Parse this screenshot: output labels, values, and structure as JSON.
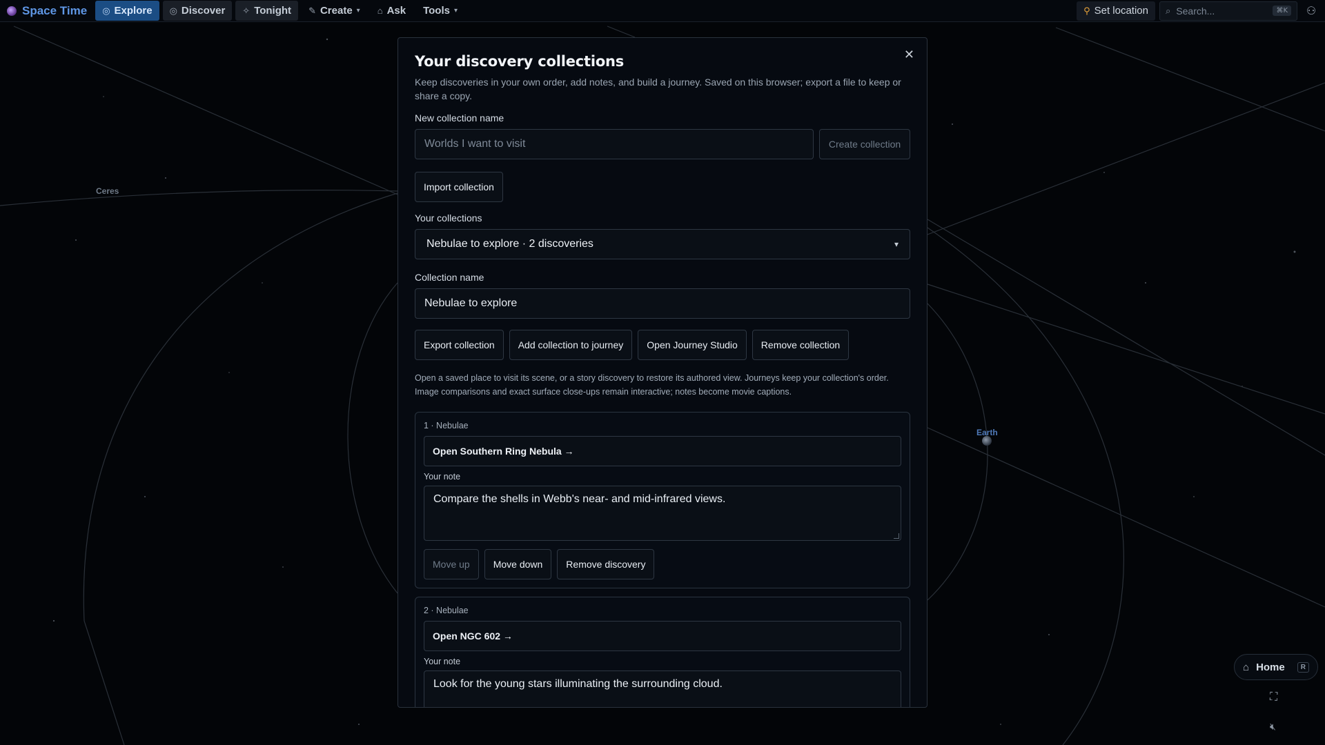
{
  "topbar": {
    "brand": "Space Time",
    "nav": [
      {
        "label": "Explore",
        "icon": "compass-icon"
      },
      {
        "label": "Discover",
        "icon": "compass-icon"
      },
      {
        "label": "Tonight",
        "icon": "sparkle-icon"
      },
      {
        "label": "Create",
        "icon": "wand-icon"
      },
      {
        "label": "Ask",
        "icon": "robot-icon"
      },
      {
        "label": "Tools",
        "icon": ""
      }
    ],
    "set_location": "Set location",
    "search_placeholder": "Search...",
    "search_shortcut": "⌘K"
  },
  "scene": {
    "labels": {
      "ceres": "Ceres",
      "earth": "Earth"
    }
  },
  "modal": {
    "title": "Your discovery collections",
    "subtitle": "Keep discoveries in your own order, add notes, and build a journey. Saved on this browser; export a file to keep or share a copy.",
    "new_name_label": "New collection name",
    "new_name_placeholder": "Worlds I want to visit",
    "create_button": "Create collection",
    "import_button": "Import collection",
    "collections_label": "Your collections",
    "selected_collection": "Nebulae to explore · 2 discoveries",
    "collection_name_label": "Collection name",
    "collection_name_value": "Nebulae to explore",
    "actions": {
      "export": "Export collection",
      "add_to_journey": "Add collection to journey",
      "open_studio": "Open Journey Studio",
      "remove": "Remove collection"
    },
    "help": "Open a saved place to visit its scene, or a story discovery to restore its authored view. Journeys keep your collection's order. Image comparisons and exact surface close-ups remain interactive; notes become movie captions.",
    "items": [
      {
        "tag": "1 · Nebulae",
        "open_label": "Open Southern Ring Nebula →",
        "note_label": "Your note",
        "note": "Compare the shells in Webb's near- and mid-infrared views.",
        "move_up": "Move up",
        "move_down": "Move down",
        "remove": "Remove discovery"
      },
      {
        "tag": "2 · Nebulae",
        "open_label": "Open NGC 602 →",
        "note_label": "Your note",
        "note": "Look for the young stars illuminating the surrounding cloud."
      }
    ]
  },
  "controls": {
    "home": "Home",
    "home_shortcut": "R"
  },
  "colors": {
    "accent": "#1b4d84",
    "brand": "#5f97e6",
    "pin": "#e8a33a",
    "background": "#030508"
  }
}
